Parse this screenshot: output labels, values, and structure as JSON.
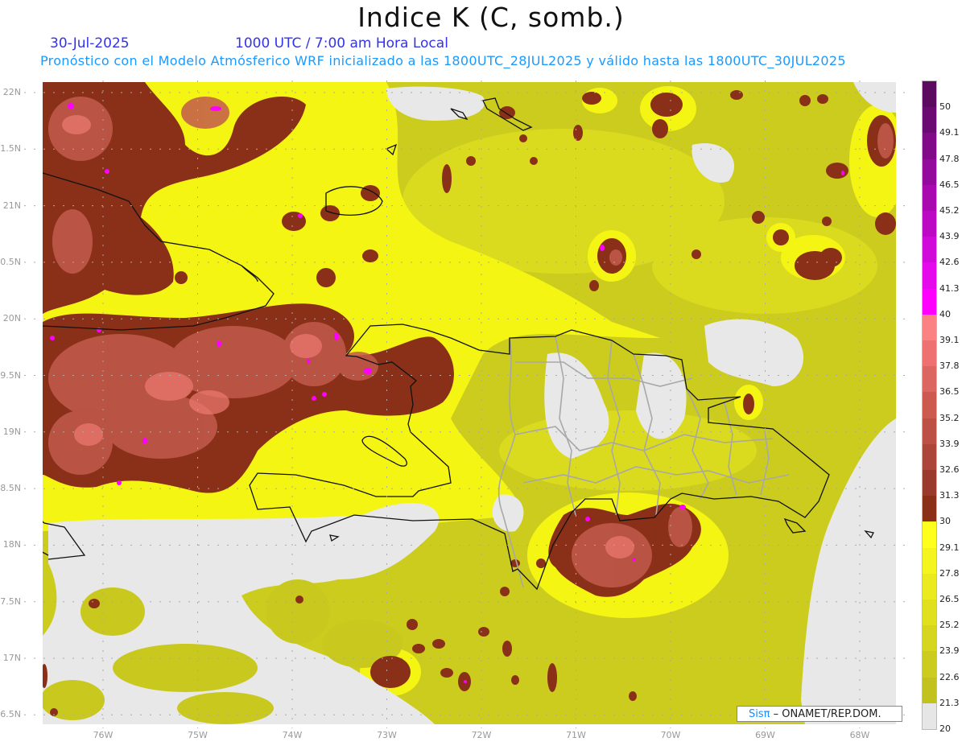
{
  "header": {
    "title": "Indice K (C, somb.)",
    "date": "30-Jul-2025",
    "time": "1000 UTC / 7:00 am Hora Local",
    "subtitle": "Pronóstico con el Modelo Atmósferico WRF inicializado a las 1800UTC_28JUL2025 y válido hasta las  1800UTC_30JUL2025"
  },
  "axes": {
    "lat_labels": [
      "22N",
      "1.5N",
      "21N",
      "0.5N",
      "20N",
      "9.5N",
      "19N",
      "8.5N",
      "18N",
      "7.5N",
      "17N",
      "6.5N"
    ],
    "lon_labels": [
      "76W",
      "75W",
      "74W",
      "73W",
      "72W",
      "71W",
      "70W",
      "69W",
      "68W"
    ]
  },
  "colorbar": {
    "labels": [
      "50",
      "49.1",
      "47.8",
      "46.5",
      "45.2",
      "43.9",
      "42.6",
      "41.3",
      "40",
      "39.1",
      "37.8",
      "36.5",
      "35.2",
      "33.9",
      "32.6",
      "31.3",
      "30",
      "29.1",
      "27.8",
      "26.5",
      "25.2",
      "23.9",
      "22.6",
      "21.3",
      "20"
    ],
    "colors": [
      "#5c0a60",
      "#6c0a74",
      "#800a88",
      "#940a9c",
      "#a80ab0",
      "#bc0ac4",
      "#d00ad8",
      "#e40aec",
      "#ff00ff",
      "#fa8282",
      "#ee7070",
      "#dc6660",
      "#cc5a4e",
      "#bc5044",
      "#ac463a",
      "#9a3a2c",
      "#8a3018",
      "#ffff1e",
      "#f4f41e",
      "#eaea1e",
      "#e0e01e",
      "#d6d61e",
      "#cccc1e",
      "#c2c21e",
      "#e6e6e6"
    ]
  },
  "credit": {
    "brand": "Sisπ",
    "text": " – ONAMET/REP.DOM."
  }
}
